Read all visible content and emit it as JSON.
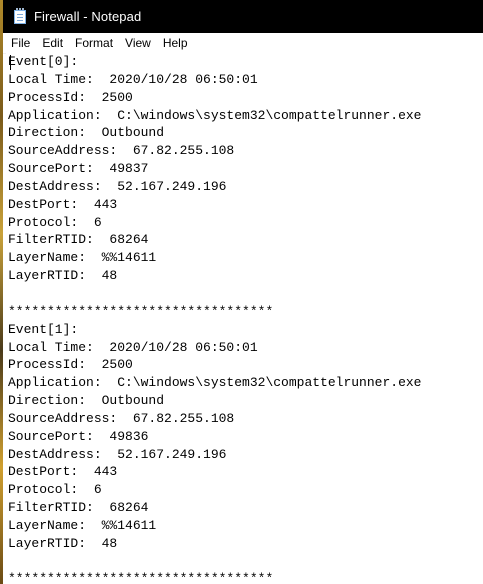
{
  "window": {
    "title": "Firewall - Notepad"
  },
  "menu": {
    "items": [
      "File",
      "Edit",
      "Format",
      "View",
      "Help"
    ]
  },
  "editor": {
    "lines": [
      "Event[0]:",
      "Local Time:  2020/10/28 06:50:01",
      "ProcessId:  2500",
      "Application:  C:\\windows\\system32\\compattelrunner.exe",
      "Direction:  Outbound",
      "SourceAddress:  67.82.255.108",
      "SourcePort:  49837",
      "DestAddress:  52.167.249.196",
      "DestPort:  443",
      "Protocol:  6",
      "FilterRTID:  68264",
      "LayerName:  %%14611",
      "LayerRTID:  48",
      "",
      "**********************************",
      "Event[1]:",
      "Local Time:  2020/10/28 06:50:01",
      "ProcessId:  2500",
      "Application:  C:\\windows\\system32\\compattelrunner.exe",
      "Direction:  Outbound",
      "SourceAddress:  67.82.255.108",
      "SourcePort:  49836",
      "DestAddress:  52.167.249.196",
      "DestPort:  443",
      "Protocol:  6",
      "FilterRTID:  68264",
      "LayerName:  %%14611",
      "LayerRTID:  48",
      "",
      "**********************************"
    ]
  }
}
